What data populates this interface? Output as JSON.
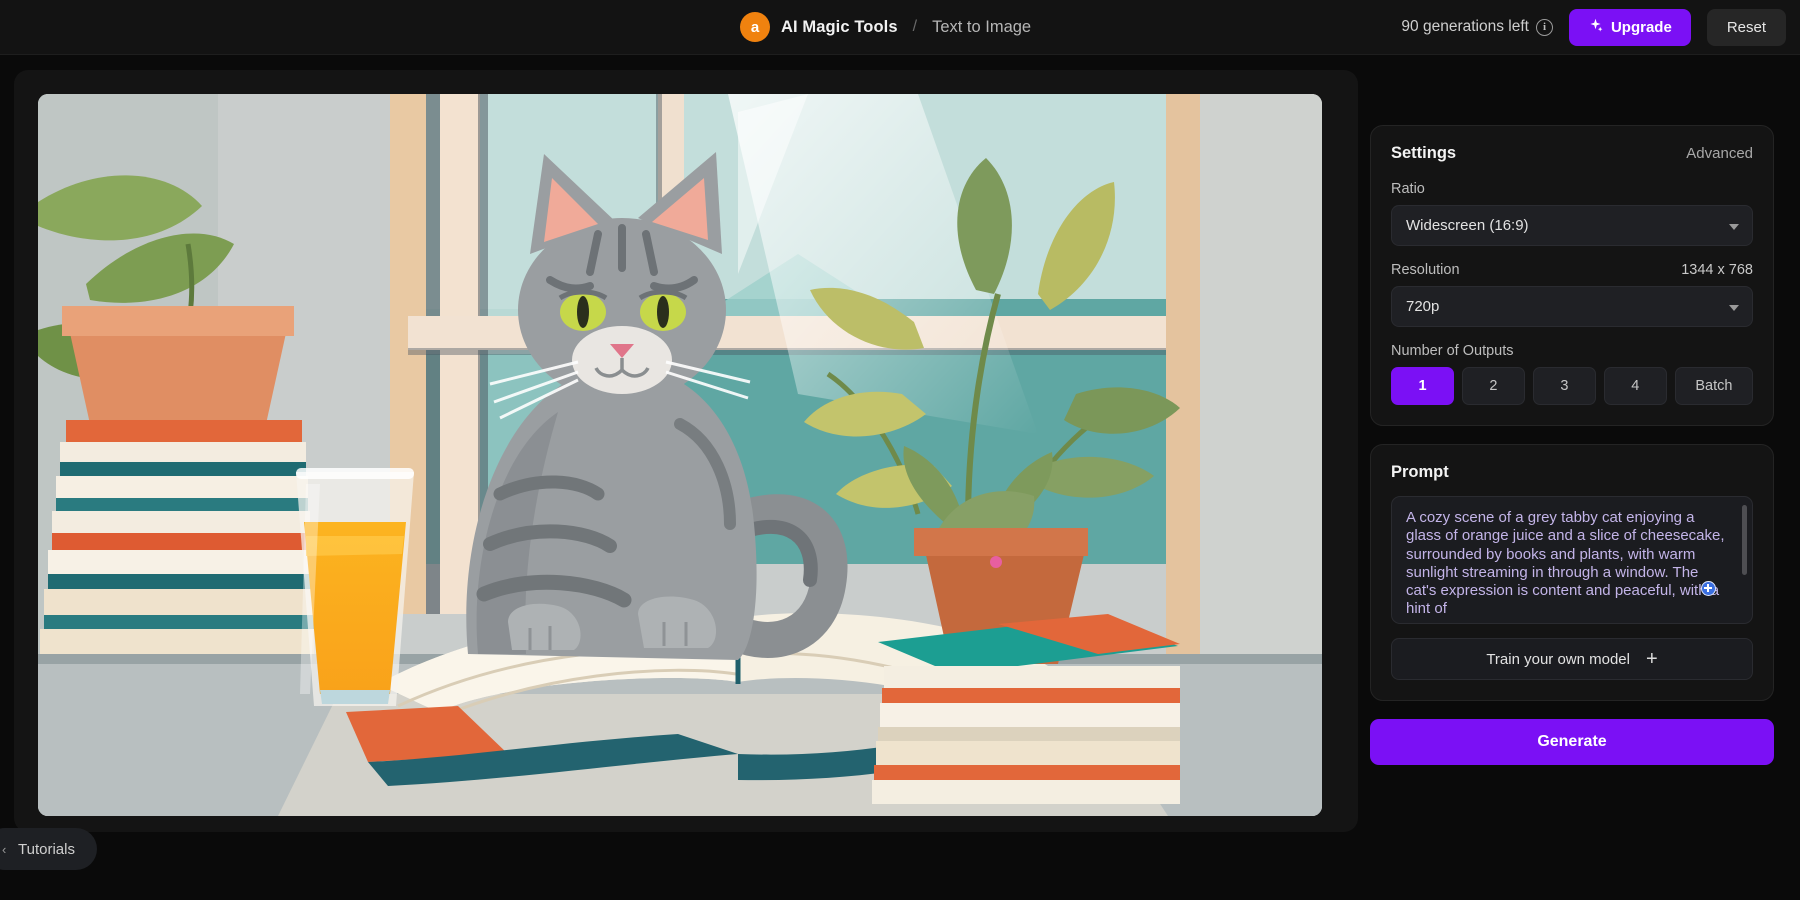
{
  "topbar": {
    "avatar_letter": "a",
    "brand": "AI Magic Tools",
    "separator": "/",
    "current_page": "Text to Image",
    "generations_left": "90 generations left",
    "info_glyph": "i",
    "upgrade_label": "Upgrade",
    "upgrade_icon": "sparkle-icon",
    "reset_label": "Reset",
    "accent_color": "#7b10f5",
    "avatar_color": "#f0820f"
  },
  "settings": {
    "title": "Settings",
    "advanced_label": "Advanced",
    "ratio_label": "Ratio",
    "ratio_value": "Widescreen (16:9)",
    "resolution_label": "Resolution",
    "resolution_dimensions": "1344 x 768",
    "resolution_value": "720p",
    "outputs_label": "Number of Outputs",
    "outputs_options": [
      "1",
      "2",
      "3",
      "4",
      "Batch"
    ],
    "outputs_selected": "1"
  },
  "prompt": {
    "title": "Prompt",
    "value": "A cozy scene of a grey tabby cat enjoying a glass of orange juice and a slice of cheesecake, surrounded by books and plants, with warm sunlight streaming in through a window. The cat's expression is content and peaceful, with a hint of",
    "train_label": "Train your own model",
    "train_icon": "plus-icon"
  },
  "actions": {
    "generate_label": "Generate"
  },
  "footer": {
    "tutorials_label": "Tutorials",
    "tutorials_arrow": "‹"
  },
  "artwork": {
    "alt": "Illustration of a grey tabby cat sitting on an open book by a sunlit window with orange juice, stacked books and potted plants"
  }
}
